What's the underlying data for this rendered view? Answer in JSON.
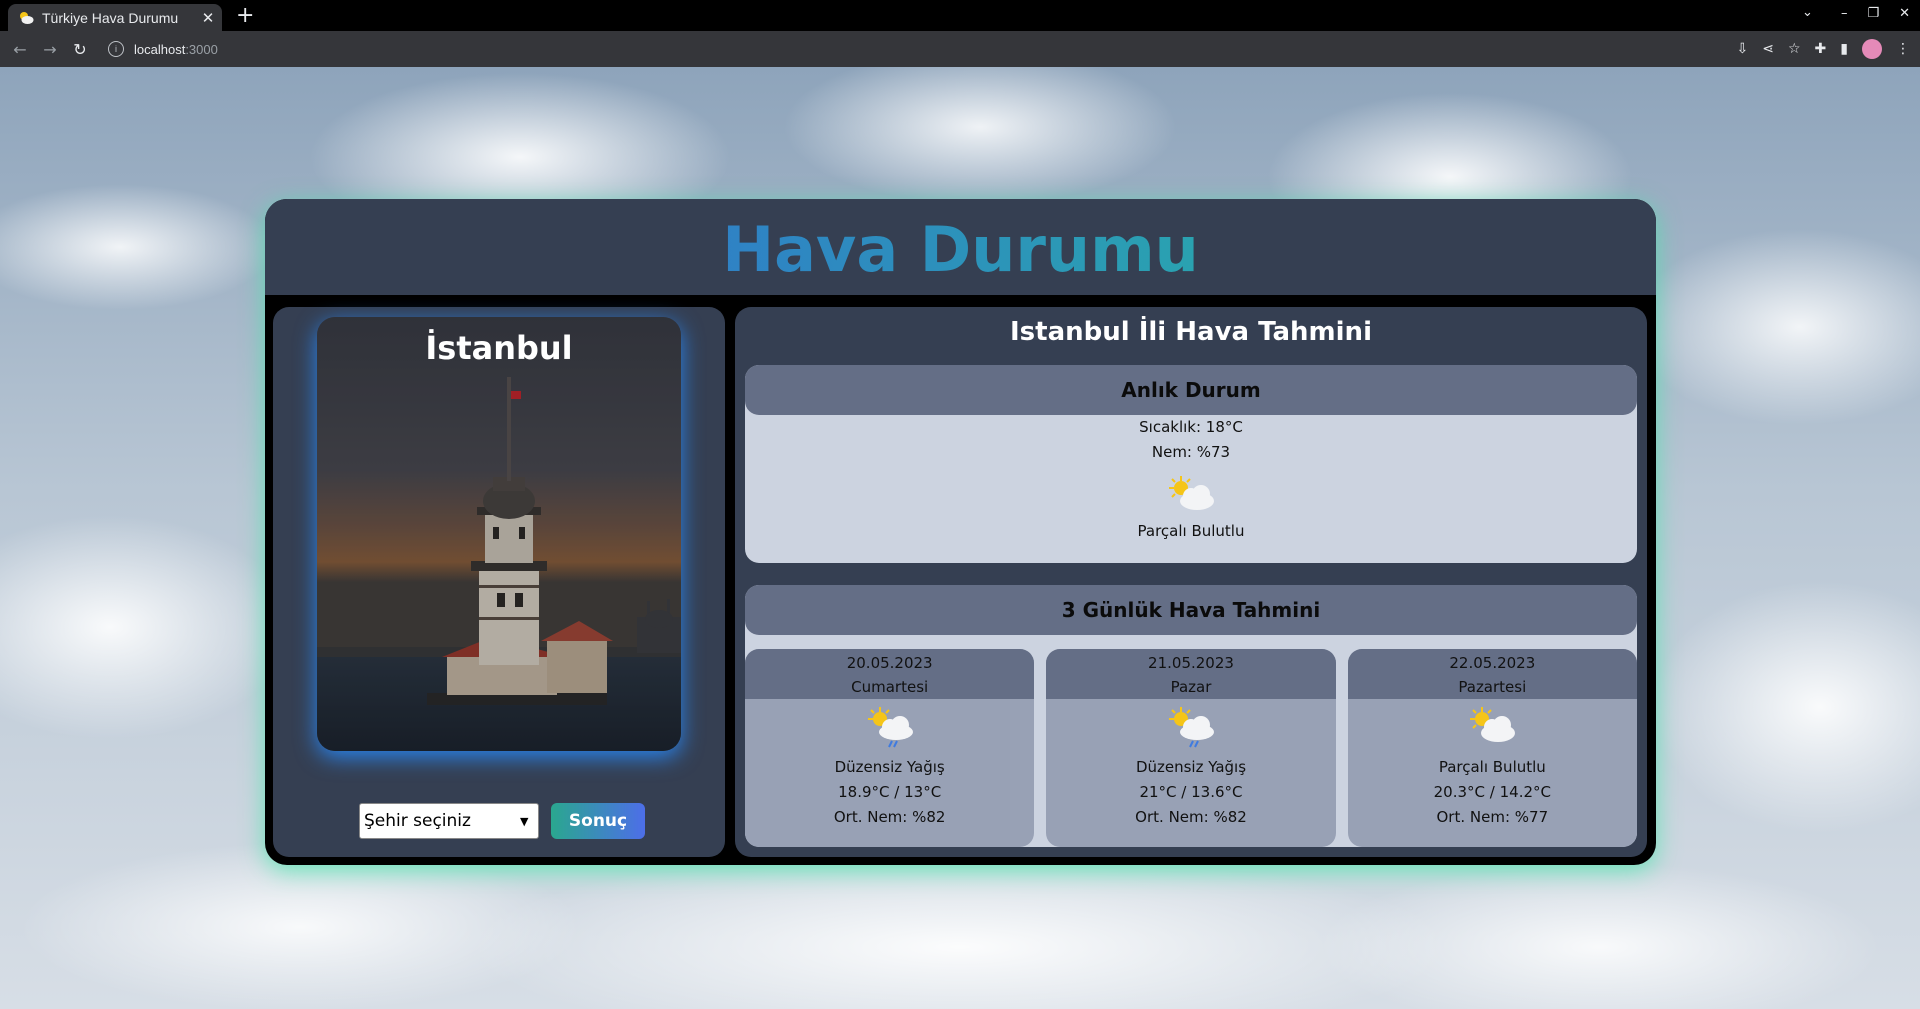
{
  "browser": {
    "tab_title": "Türkiye Hava Durumu",
    "url_host": "localhost",
    "url_port": ":3000"
  },
  "app": {
    "title": "Hava Durumu"
  },
  "city": {
    "name": "İstanbul",
    "select_placeholder": "Şehir seçiniz",
    "submit_label": "Sonuç"
  },
  "forecast": {
    "title": "Istanbul İli Hava Tahmini",
    "current": {
      "heading": "Anlık Durum",
      "temperature": "Sıcaklık: 18°C",
      "humidity": "Nem: %73",
      "icon": "partly-cloudy-icon",
      "condition": "Parçalı Bulutlu"
    },
    "three_day": {
      "heading": "3 Günlük Hava Tahmini",
      "days": [
        {
          "date": "20.05.2023",
          "weekday": "Cumartesi",
          "icon": "rain-cloud-sun-icon",
          "condition": "Düzensiz Yağış",
          "temps": "18.9°C / 13°C",
          "humidity": "Ort. Nem: %82"
        },
        {
          "date": "21.05.2023",
          "weekday": "Pazar",
          "icon": "rain-cloud-sun-icon",
          "condition": "Düzensiz Yağış",
          "temps": "21°C / 13.6°C",
          "humidity": "Ort. Nem: %82"
        },
        {
          "date": "22.05.2023",
          "weekday": "Pazartesi",
          "icon": "partly-cloudy-icon",
          "condition": "Parçalı Bulutlu",
          "temps": "20.3°C / 14.2°C",
          "humidity": "Ort. Nem: %77"
        }
      ]
    }
  },
  "colors": {
    "card_bg": "#353f52",
    "section_head": "#646e86",
    "section_body": "#ccd3e0",
    "day_body": "#98a1b5",
    "glow": "#46e6aa"
  }
}
